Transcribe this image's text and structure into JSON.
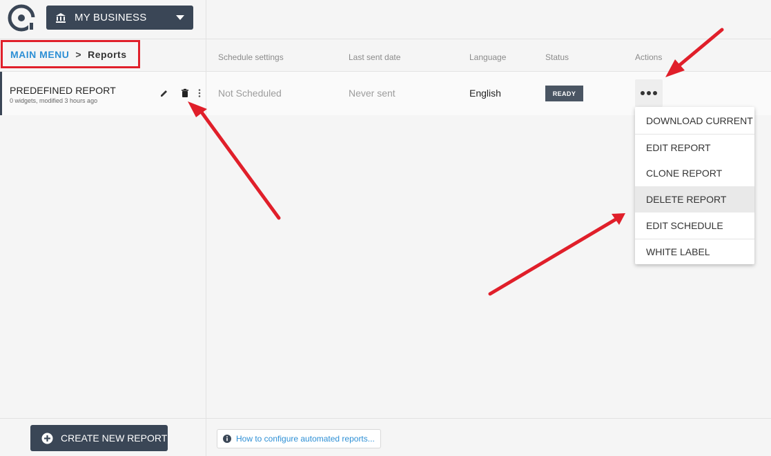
{
  "header": {
    "business_label": "MY BUSINESS"
  },
  "breadcrumb": {
    "main": "MAIN MENU",
    "separator": ">",
    "current": "Reports"
  },
  "sidebar": {
    "reports": [
      {
        "title": "PREDEFINED REPORT",
        "meta": "0 widgets, modified 3 hours ago"
      }
    ],
    "create_label": "CREATE NEW REPORT"
  },
  "table": {
    "columns": [
      "Schedule settings",
      "Last sent date",
      "Language",
      "Status",
      "Actions"
    ],
    "rows": [
      {
        "schedule": "Not Scheduled",
        "last_sent": "Never sent",
        "language": "English",
        "status": "READY"
      }
    ]
  },
  "actions_menu": {
    "items": [
      "DOWNLOAD CURRENT",
      "EDIT REPORT",
      "CLONE REPORT",
      "DELETE REPORT",
      "EDIT SCHEDULE",
      "WHITE LABEL"
    ],
    "highlighted": "DELETE REPORT"
  },
  "help": {
    "link_text": "How to configure automated reports..."
  },
  "colors": {
    "primary_dark": "#3a4656",
    "link_blue": "#2d8fd5",
    "annotation_red": "#e01f2a",
    "status_badge": "#4a5563"
  },
  "icons": [
    "logo-icon",
    "bank-icon",
    "caret-down-icon",
    "edit-icon",
    "trash-icon",
    "more-vertical-icon",
    "more-horizontal-icon",
    "plus-circle-icon",
    "info-icon"
  ]
}
